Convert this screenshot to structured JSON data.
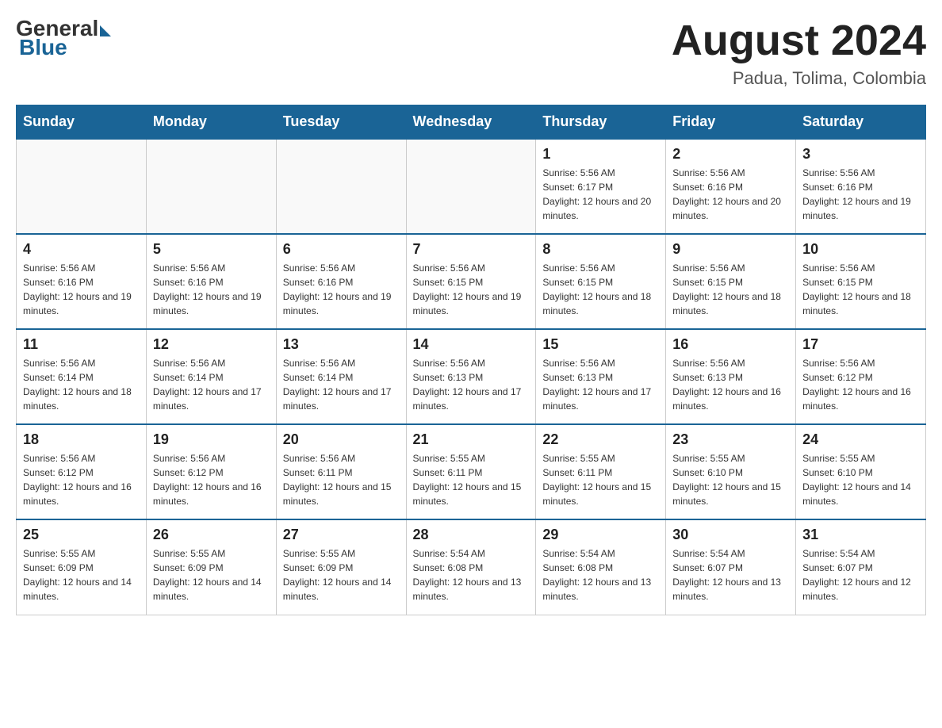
{
  "header": {
    "logo": {
      "general": "General",
      "blue": "Blue"
    },
    "title": "August 2024",
    "location": "Padua, Tolima, Colombia"
  },
  "days_of_week": [
    "Sunday",
    "Monday",
    "Tuesday",
    "Wednesday",
    "Thursday",
    "Friday",
    "Saturday"
  ],
  "weeks": [
    [
      {
        "day": "",
        "info": ""
      },
      {
        "day": "",
        "info": ""
      },
      {
        "day": "",
        "info": ""
      },
      {
        "day": "",
        "info": ""
      },
      {
        "day": "1",
        "info": "Sunrise: 5:56 AM\nSunset: 6:17 PM\nDaylight: 12 hours and 20 minutes."
      },
      {
        "day": "2",
        "info": "Sunrise: 5:56 AM\nSunset: 6:16 PM\nDaylight: 12 hours and 20 minutes."
      },
      {
        "day": "3",
        "info": "Sunrise: 5:56 AM\nSunset: 6:16 PM\nDaylight: 12 hours and 19 minutes."
      }
    ],
    [
      {
        "day": "4",
        "info": "Sunrise: 5:56 AM\nSunset: 6:16 PM\nDaylight: 12 hours and 19 minutes."
      },
      {
        "day": "5",
        "info": "Sunrise: 5:56 AM\nSunset: 6:16 PM\nDaylight: 12 hours and 19 minutes."
      },
      {
        "day": "6",
        "info": "Sunrise: 5:56 AM\nSunset: 6:16 PM\nDaylight: 12 hours and 19 minutes."
      },
      {
        "day": "7",
        "info": "Sunrise: 5:56 AM\nSunset: 6:15 PM\nDaylight: 12 hours and 19 minutes."
      },
      {
        "day": "8",
        "info": "Sunrise: 5:56 AM\nSunset: 6:15 PM\nDaylight: 12 hours and 18 minutes."
      },
      {
        "day": "9",
        "info": "Sunrise: 5:56 AM\nSunset: 6:15 PM\nDaylight: 12 hours and 18 minutes."
      },
      {
        "day": "10",
        "info": "Sunrise: 5:56 AM\nSunset: 6:15 PM\nDaylight: 12 hours and 18 minutes."
      }
    ],
    [
      {
        "day": "11",
        "info": "Sunrise: 5:56 AM\nSunset: 6:14 PM\nDaylight: 12 hours and 18 minutes."
      },
      {
        "day": "12",
        "info": "Sunrise: 5:56 AM\nSunset: 6:14 PM\nDaylight: 12 hours and 17 minutes."
      },
      {
        "day": "13",
        "info": "Sunrise: 5:56 AM\nSunset: 6:14 PM\nDaylight: 12 hours and 17 minutes."
      },
      {
        "day": "14",
        "info": "Sunrise: 5:56 AM\nSunset: 6:13 PM\nDaylight: 12 hours and 17 minutes."
      },
      {
        "day": "15",
        "info": "Sunrise: 5:56 AM\nSunset: 6:13 PM\nDaylight: 12 hours and 17 minutes."
      },
      {
        "day": "16",
        "info": "Sunrise: 5:56 AM\nSunset: 6:13 PM\nDaylight: 12 hours and 16 minutes."
      },
      {
        "day": "17",
        "info": "Sunrise: 5:56 AM\nSunset: 6:12 PM\nDaylight: 12 hours and 16 minutes."
      }
    ],
    [
      {
        "day": "18",
        "info": "Sunrise: 5:56 AM\nSunset: 6:12 PM\nDaylight: 12 hours and 16 minutes."
      },
      {
        "day": "19",
        "info": "Sunrise: 5:56 AM\nSunset: 6:12 PM\nDaylight: 12 hours and 16 minutes."
      },
      {
        "day": "20",
        "info": "Sunrise: 5:56 AM\nSunset: 6:11 PM\nDaylight: 12 hours and 15 minutes."
      },
      {
        "day": "21",
        "info": "Sunrise: 5:55 AM\nSunset: 6:11 PM\nDaylight: 12 hours and 15 minutes."
      },
      {
        "day": "22",
        "info": "Sunrise: 5:55 AM\nSunset: 6:11 PM\nDaylight: 12 hours and 15 minutes."
      },
      {
        "day": "23",
        "info": "Sunrise: 5:55 AM\nSunset: 6:10 PM\nDaylight: 12 hours and 15 minutes."
      },
      {
        "day": "24",
        "info": "Sunrise: 5:55 AM\nSunset: 6:10 PM\nDaylight: 12 hours and 14 minutes."
      }
    ],
    [
      {
        "day": "25",
        "info": "Sunrise: 5:55 AM\nSunset: 6:09 PM\nDaylight: 12 hours and 14 minutes."
      },
      {
        "day": "26",
        "info": "Sunrise: 5:55 AM\nSunset: 6:09 PM\nDaylight: 12 hours and 14 minutes."
      },
      {
        "day": "27",
        "info": "Sunrise: 5:55 AM\nSunset: 6:09 PM\nDaylight: 12 hours and 14 minutes."
      },
      {
        "day": "28",
        "info": "Sunrise: 5:54 AM\nSunset: 6:08 PM\nDaylight: 12 hours and 13 minutes."
      },
      {
        "day": "29",
        "info": "Sunrise: 5:54 AM\nSunset: 6:08 PM\nDaylight: 12 hours and 13 minutes."
      },
      {
        "day": "30",
        "info": "Sunrise: 5:54 AM\nSunset: 6:07 PM\nDaylight: 12 hours and 13 minutes."
      },
      {
        "day": "31",
        "info": "Sunrise: 5:54 AM\nSunset: 6:07 PM\nDaylight: 12 hours and 12 minutes."
      }
    ]
  ]
}
